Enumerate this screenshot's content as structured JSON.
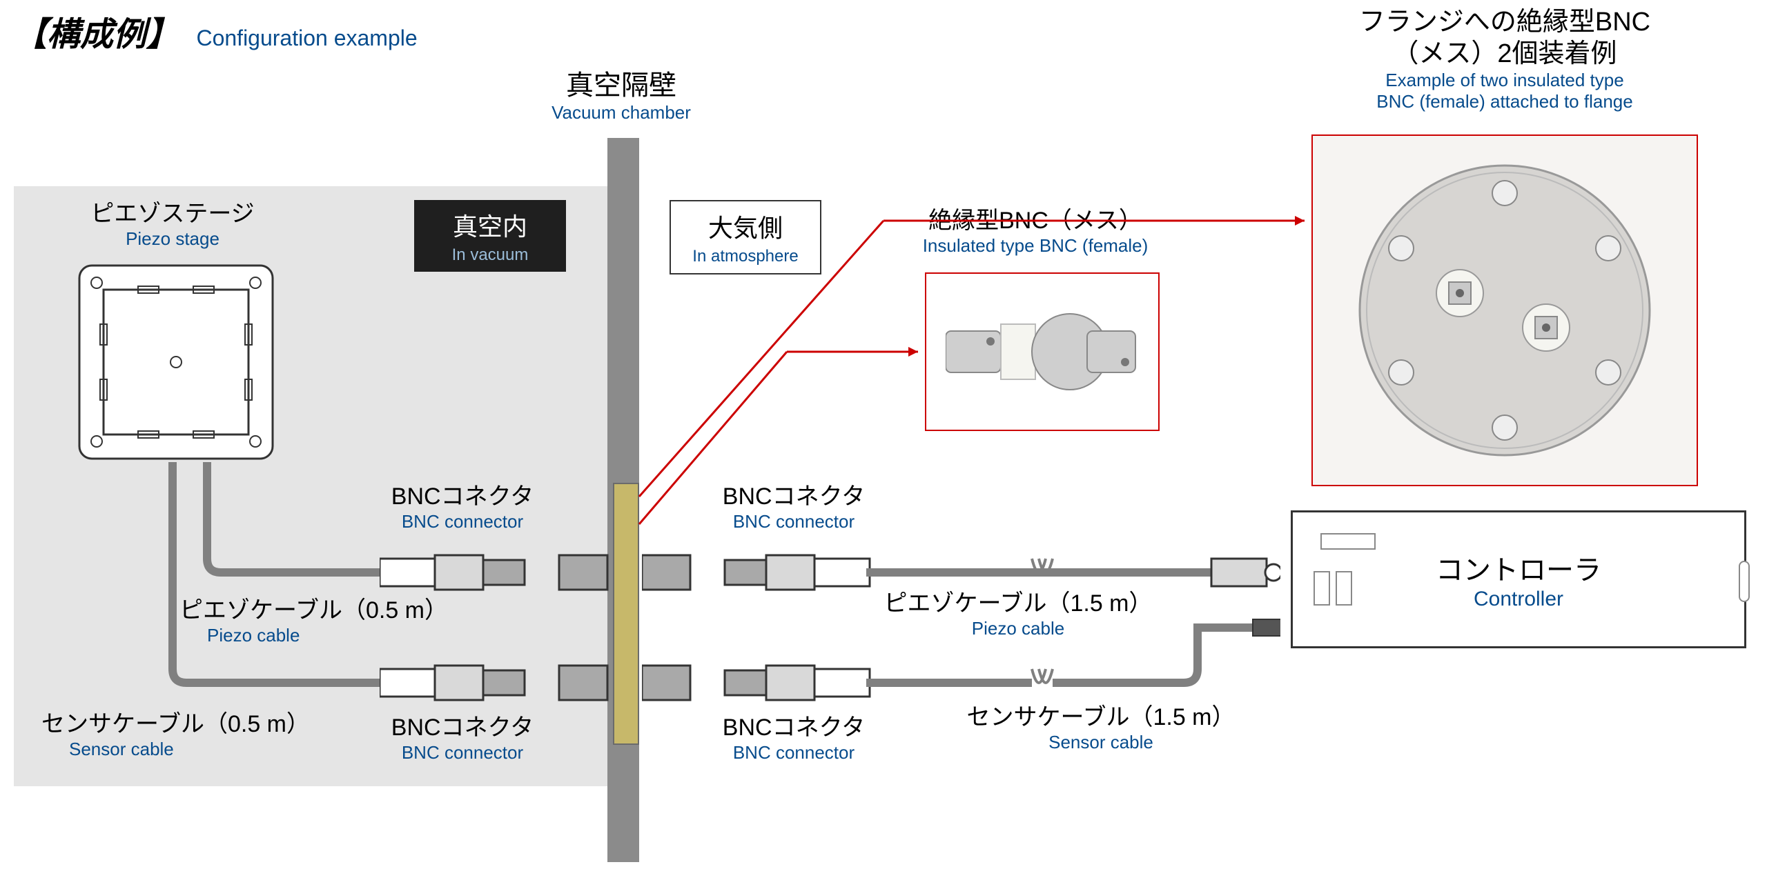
{
  "title": {
    "jp": "【構成例】",
    "en": "Configuration example"
  },
  "vacuumWall": {
    "jp": "真空隔壁",
    "en": "Vacuum chamber"
  },
  "inVacuum": {
    "jp": "真空内",
    "en": "In vacuum"
  },
  "inAtmosphere": {
    "jp": "大気側",
    "en": "In atmosphere"
  },
  "piezoStage": {
    "jp": "ピエゾステージ",
    "en": "Piezo stage"
  },
  "bncConnector": {
    "jp": "BNCコネクタ",
    "en": "BNC connector"
  },
  "piezoCableVac": {
    "jp": "ピエゾケーブル（0.5 m）",
    "en": "Piezo cable"
  },
  "sensorCableVac": {
    "jp": "センサケーブル（0.5 m）",
    "en": "Sensor cable"
  },
  "piezoCableAtm": {
    "jp": "ピエゾケーブル（1.5 m）",
    "en": "Piezo cable"
  },
  "sensorCableAtm": {
    "jp": "センサケーブル（1.5 m）",
    "en": "Sensor cable"
  },
  "insulatedBNC": {
    "jp": "絶縁型BNC（メス）",
    "en": "Insulated type BNC (female)"
  },
  "flangeBNC": {
    "jp_l1": "フランジへの絶縁型BNC",
    "jp_l2": "（メス）2個装着例",
    "en_l1": "Example of two insulated type",
    "en_l2": "BNC (female) attached to flange"
  },
  "controller": {
    "jp": "コントローラ",
    "en": "Controller"
  }
}
